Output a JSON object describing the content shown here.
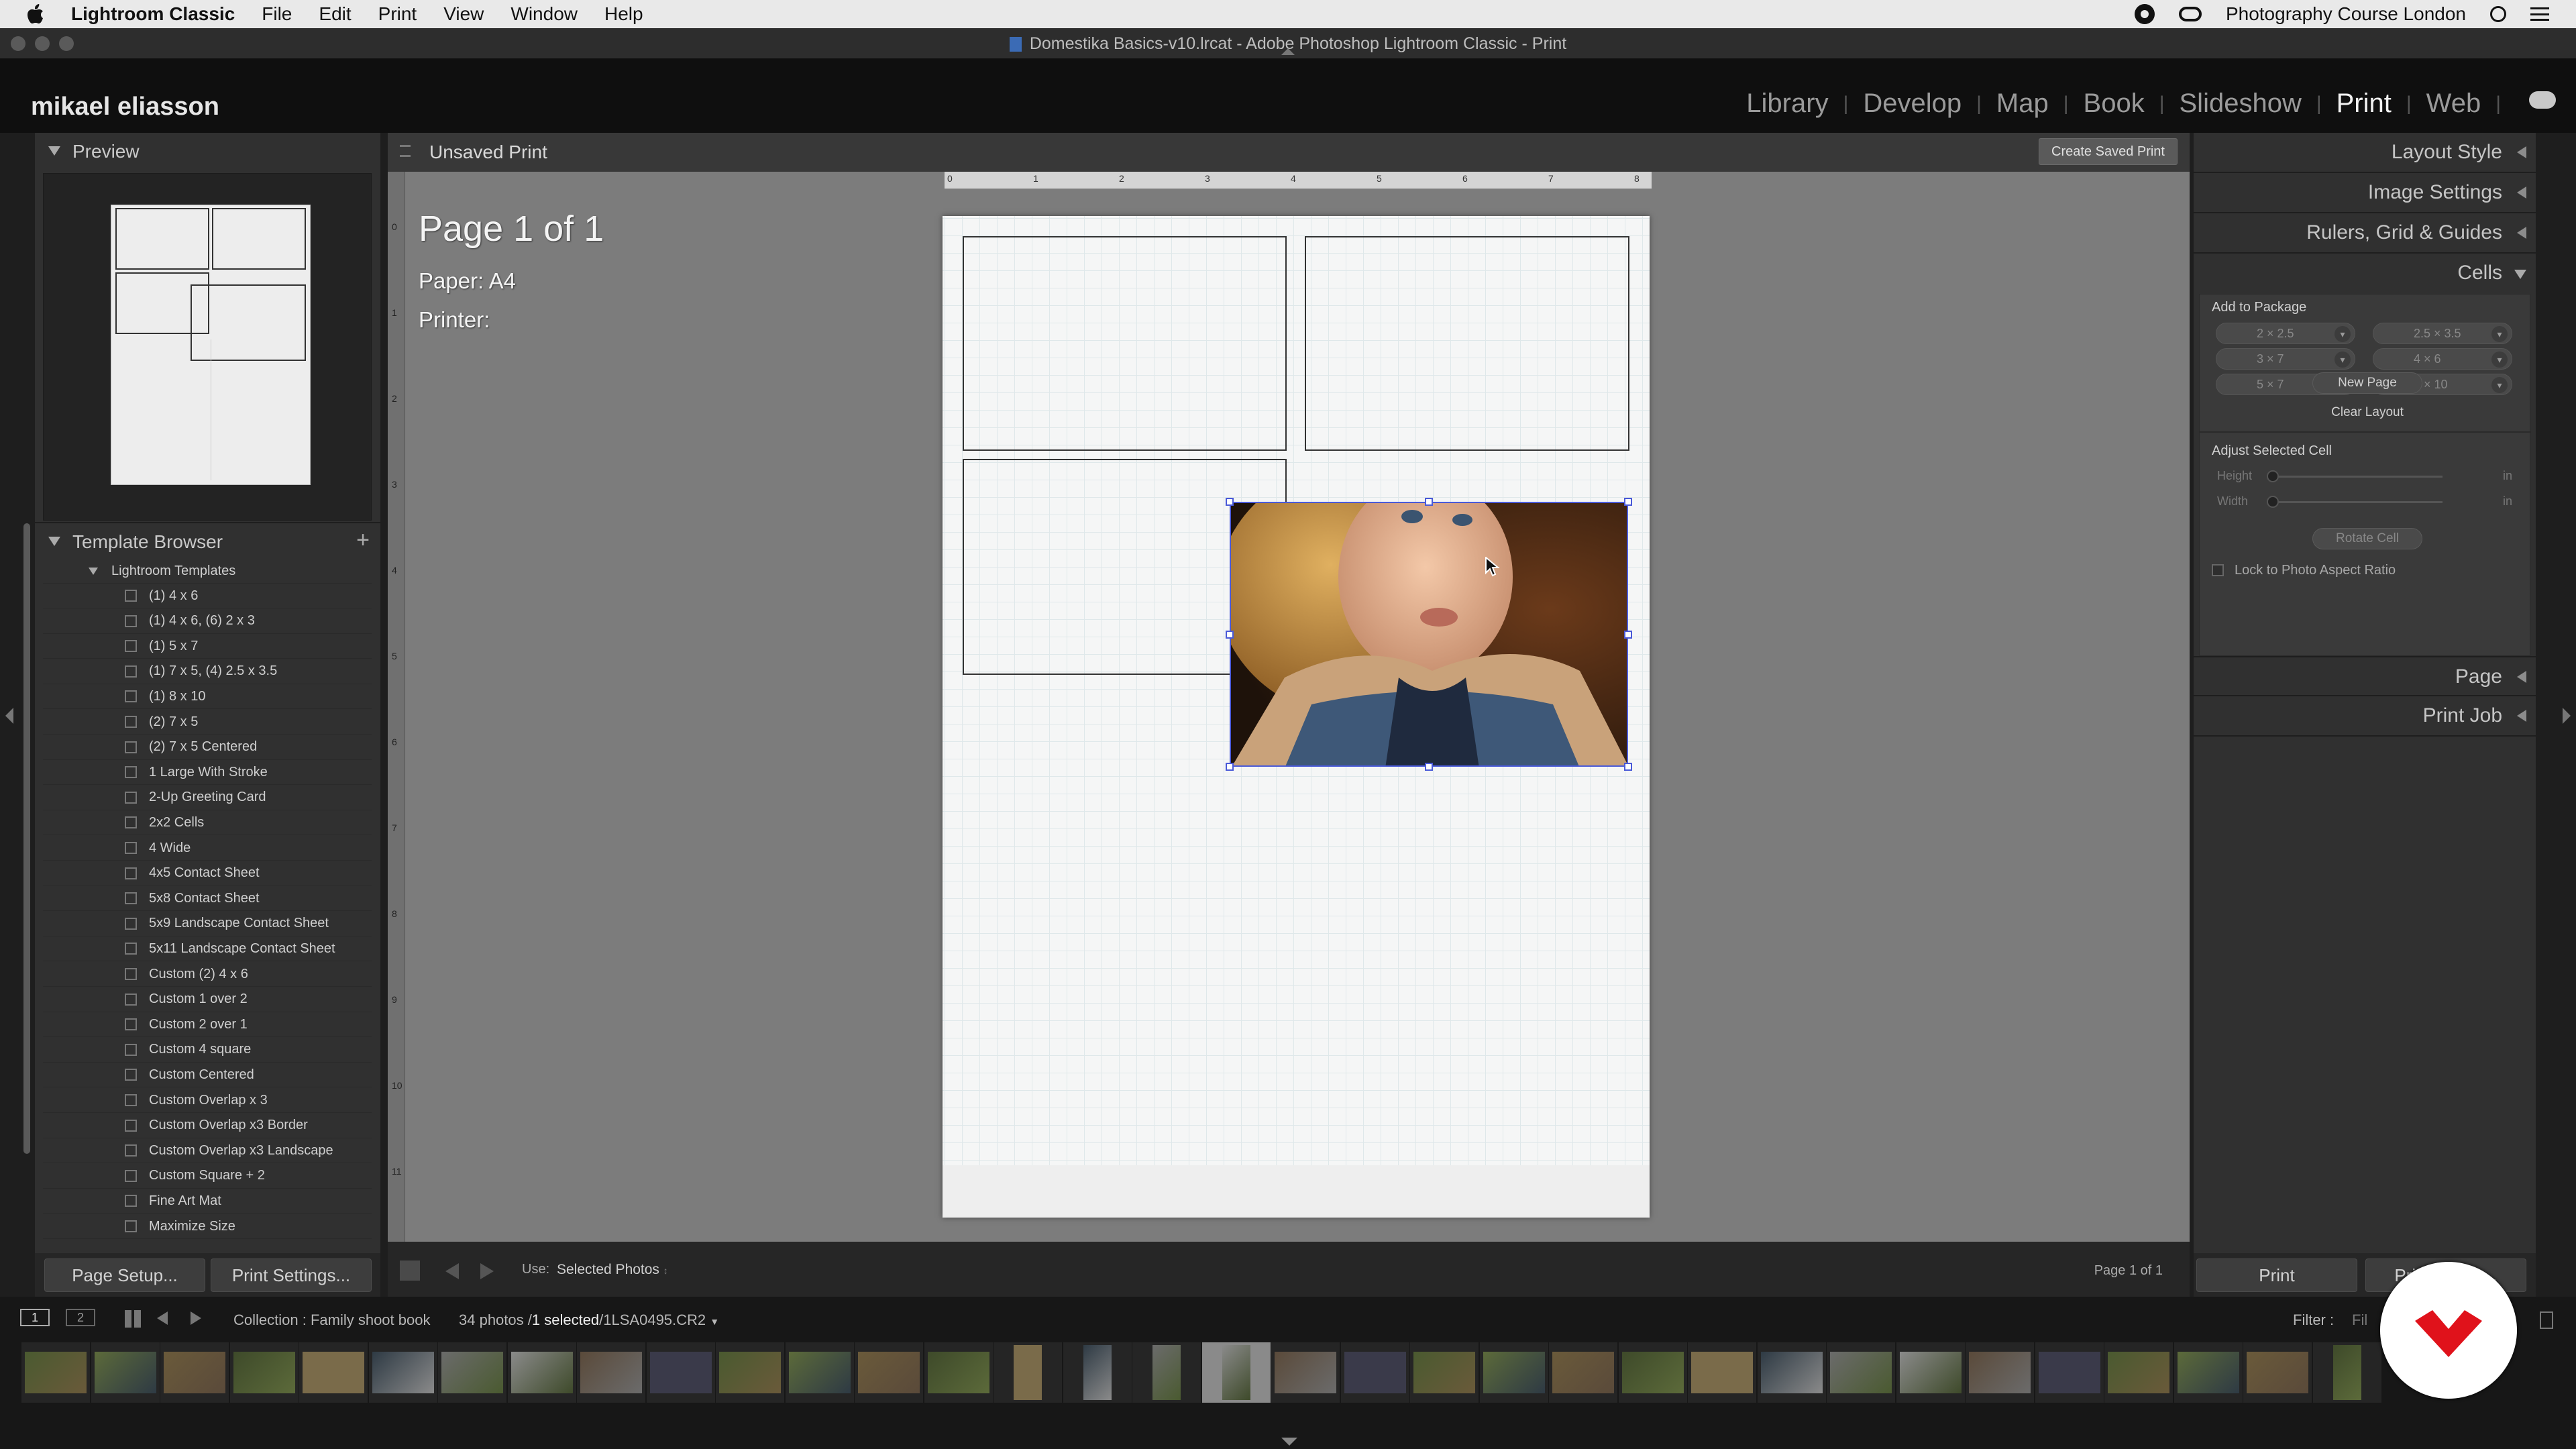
{
  "menubar": {
    "app_name": "Lightroom Classic",
    "items": [
      "File",
      "Edit",
      "Print",
      "View",
      "Window",
      "Help"
    ],
    "right_label": "Photography Course London"
  },
  "window": {
    "title": "Domestika Basics-v10.lrcat - Adobe Photoshop Lightroom Classic - Print"
  },
  "identity_plate": "mikael eliasson",
  "modules": [
    "Library",
    "Develop",
    "Map",
    "Book",
    "Slideshow",
    "Print",
    "Web"
  ],
  "active_module": "Print",
  "left_panel": {
    "preview_title": "Preview",
    "template_browser_title": "Template Browser",
    "template_folder": "Lightroom Templates",
    "templates": [
      "(1) 4 x 6",
      "(1) 4 x 6, (6) 2 x 3",
      "(1) 5 x 7",
      "(1) 7 x 5, (4) 2.5 x 3.5",
      "(1) 8 x 10",
      "(2) 7 x 5",
      "(2) 7 x 5 Centered",
      "1 Large With Stroke",
      "2-Up Greeting Card",
      "2x2 Cells",
      "4 Wide",
      "4x5 Contact Sheet",
      "5x8 Contact Sheet",
      "5x9 Landscape Contact Sheet",
      "5x11 Landscape Contact Sheet",
      "Custom (2) 4 x 6",
      "Custom 1 over 2",
      "Custom 2 over 1",
      "Custom 4 square",
      "Custom Centered",
      "Custom Overlap x 3",
      "Custom Overlap x3 Border",
      "Custom Overlap x3 Landscape",
      "Custom Square + 2",
      "Fine Art Mat",
      "Maximize Size"
    ],
    "page_setup_label": "Page Setup...",
    "print_settings_label": "Print Settings..."
  },
  "center": {
    "header_title": "Unsaved Print",
    "create_saved_print": "Create Saved Print",
    "page_info": "Page 1 of 1",
    "paper_label": "Paper:",
    "paper_value": "A4",
    "printer_label": "Printer:",
    "ruler_numbers": [
      "0",
      "1",
      "2",
      "3",
      "4",
      "5",
      "6",
      "7",
      "8"
    ],
    "vruler_numbers": [
      "0",
      "1",
      "2",
      "3",
      "4",
      "5",
      "6",
      "7",
      "8",
      "9",
      "10",
      "11"
    ],
    "toolbar_use_label": "Use:",
    "toolbar_use_value": "Selected Photos",
    "toolbar_page": "Page 1 of 1"
  },
  "right_panel": {
    "sections": [
      "Layout Style",
      "Image Settings",
      "Rulers, Grid & Guides",
      "Cells"
    ],
    "add_to_package": "Add to Package",
    "package_sizes": [
      "2 × 2.5",
      "2.5 × 3.5",
      "3 × 7",
      "4 × 6",
      "5 × 7",
      "8 × 10"
    ],
    "new_page": "New Page",
    "clear_layout": "Clear Layout",
    "adjust_selected_cell": "Adjust Selected Cell",
    "height_label": "Height",
    "width_label": "Width",
    "unit": "in",
    "rotate_cell": "Rotate Cell",
    "lock_aspect": "Lock to Photo Aspect Ratio",
    "bottom_sections": [
      "Page",
      "Print Job"
    ],
    "print_button": "Print",
    "print_to_file_button": "Print to File..."
  },
  "filmstrip": {
    "screen_1": "1",
    "screen_2": "2",
    "collection_text": "Collection : Family shoot book",
    "count_text": "34 photos /",
    "selected_text": "1 selected",
    "filename": "/1LSA0495.CR2",
    "filter_label": "Filter :",
    "filter_value": "Fil"
  },
  "colors": {
    "accent_brand": "#e0121b",
    "selection_handle": "#4a5ad8",
    "background_dark": "#1e1e1e"
  }
}
